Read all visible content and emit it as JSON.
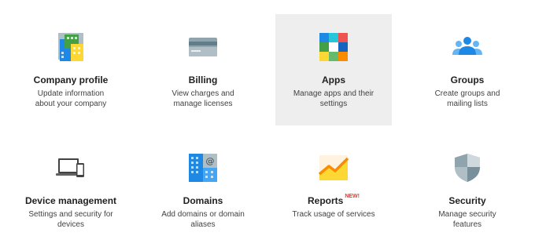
{
  "tiles": [
    {
      "title": "Company profile",
      "desc_line1": "Update information",
      "desc_line2": "about your company",
      "icon": "company-building-icon"
    },
    {
      "title": "Billing",
      "desc_line1": "View charges and",
      "desc_line2": "manage licenses",
      "icon": "credit-card-icon"
    },
    {
      "title": "Apps",
      "desc_line1": "Manage apps and their",
      "desc_line2": "settings",
      "icon": "apps-grid-icon"
    },
    {
      "title": "Groups",
      "desc_line1": "Create groups and",
      "desc_line2": "mailing lists",
      "icon": "people-group-icon"
    },
    {
      "title": "Device management",
      "desc_line1": "Settings and security for",
      "desc_line2": "devices",
      "icon": "laptop-phone-icon"
    },
    {
      "title": "Domains",
      "desc_line1": "Add domains or domain",
      "desc_line2": "aliases",
      "icon": "domain-at-icon"
    },
    {
      "title": "Reports",
      "badge": "NEW!",
      "desc_line1": "Track usage of services",
      "desc_line2": "",
      "icon": "chart-trend-icon"
    },
    {
      "title": "Security",
      "desc_line1": "Manage security",
      "desc_line2": "features",
      "icon": "shield-icon"
    }
  ],
  "colors": {
    "highlight_bg": "#eeeeee",
    "new_badge": "#e53935"
  }
}
